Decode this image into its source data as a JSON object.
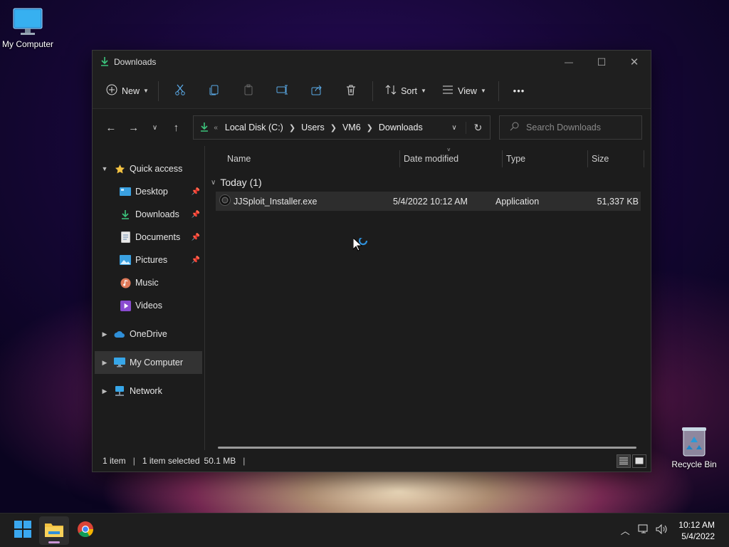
{
  "desktop": {
    "my_computer_label": "My Computer",
    "recycle_bin_label": "Recycle Bin"
  },
  "window": {
    "title": "Downloads",
    "controls": {
      "minimize": "—",
      "maximize": "☐",
      "close": "✕"
    }
  },
  "toolbar": {
    "new_label": "New",
    "sort_label": "Sort",
    "view_label": "View",
    "more_label": "•••",
    "icons": [
      "cut-icon",
      "copy-icon",
      "paste-icon",
      "rename-icon",
      "share-icon",
      "delete-icon"
    ]
  },
  "address": {
    "overflow": "«",
    "crumbs": [
      "Local Disk (C:)",
      "Users",
      "VM6",
      "Downloads"
    ]
  },
  "search": {
    "placeholder": "Search Downloads"
  },
  "nav": {
    "quick_access": "Quick access",
    "items": [
      {
        "label": "Desktop",
        "pinned": true
      },
      {
        "label": "Downloads",
        "pinned": true
      },
      {
        "label": "Documents",
        "pinned": true
      },
      {
        "label": "Pictures",
        "pinned": true
      },
      {
        "label": "Music",
        "pinned": false
      },
      {
        "label": "Videos",
        "pinned": false
      }
    ],
    "onedrive": "OneDrive",
    "my_computer": "My Computer",
    "network": "Network"
  },
  "columns": {
    "name": "Name",
    "date": "Date modified",
    "type": "Type",
    "size": "Size"
  },
  "group": {
    "label": "Today (1)"
  },
  "files": [
    {
      "name": "JJSploit_Installer.exe",
      "date": "5/4/2022 10:12 AM",
      "type": "Application",
      "size": "51,337 KB"
    }
  ],
  "status": {
    "count": "1 item",
    "selected": "1 item selected",
    "size": "50.1 MB",
    "separator": "|"
  },
  "taskbar": {
    "time": "10:12 AM",
    "date": "5/4/2022"
  },
  "colors": {
    "accent": "#2f8fd8",
    "download_green": "#3cc47c",
    "folder_yellow": "#f3c242"
  }
}
